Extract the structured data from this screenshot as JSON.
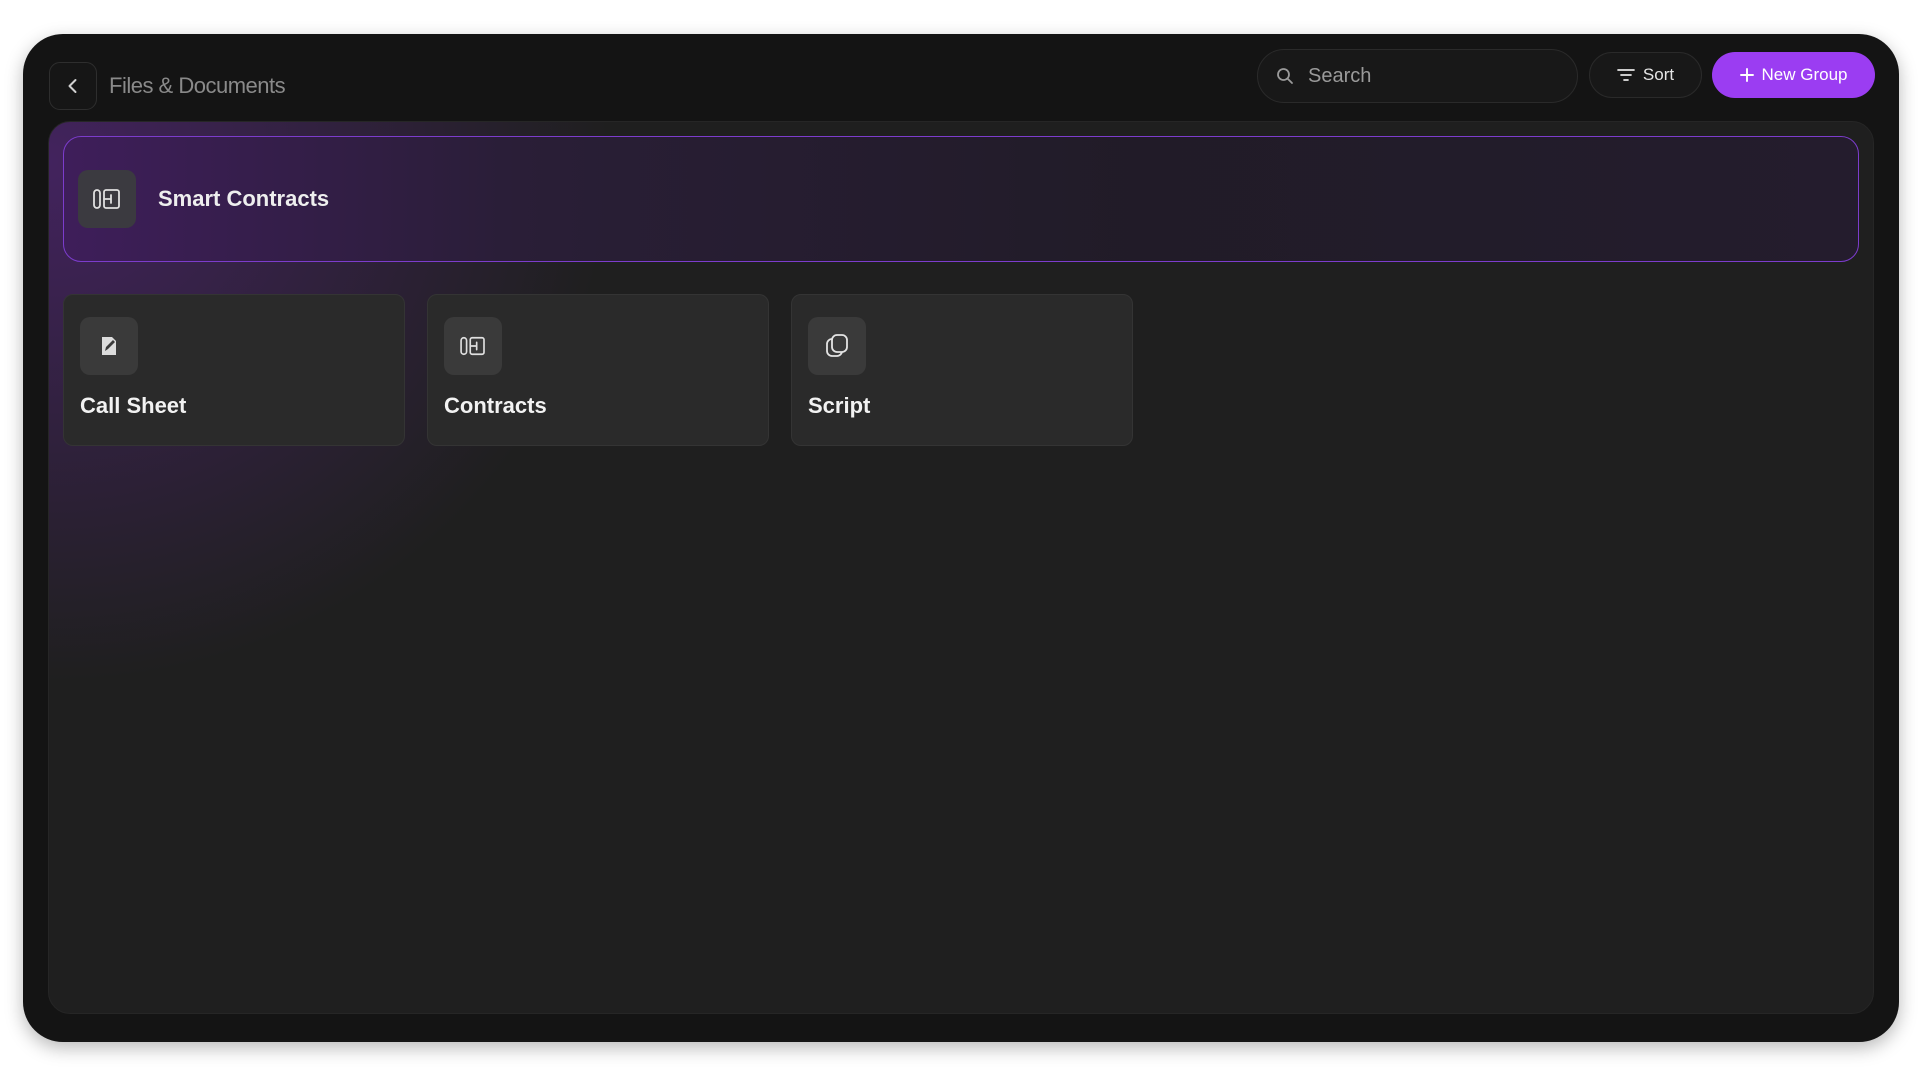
{
  "header": {
    "title": "Files & Documents",
    "back_icon": "chevron-left-icon",
    "search": {
      "placeholder": "Search",
      "value": ""
    },
    "sort_label": "Sort",
    "new_group_label": "New Group"
  },
  "featured": {
    "label": "Smart Contracts",
    "icon": "contract-icon"
  },
  "folders": [
    {
      "label": "Call Sheet",
      "icon": "edit-document-icon"
    },
    {
      "label": "Contracts",
      "icon": "contract-icon"
    },
    {
      "label": "Script",
      "icon": "copy-pages-icon"
    }
  ],
  "colors": {
    "accent": "#9b3df2",
    "background": "#141414",
    "panel": "#1f1f1f",
    "card": "#2a2a2a"
  }
}
